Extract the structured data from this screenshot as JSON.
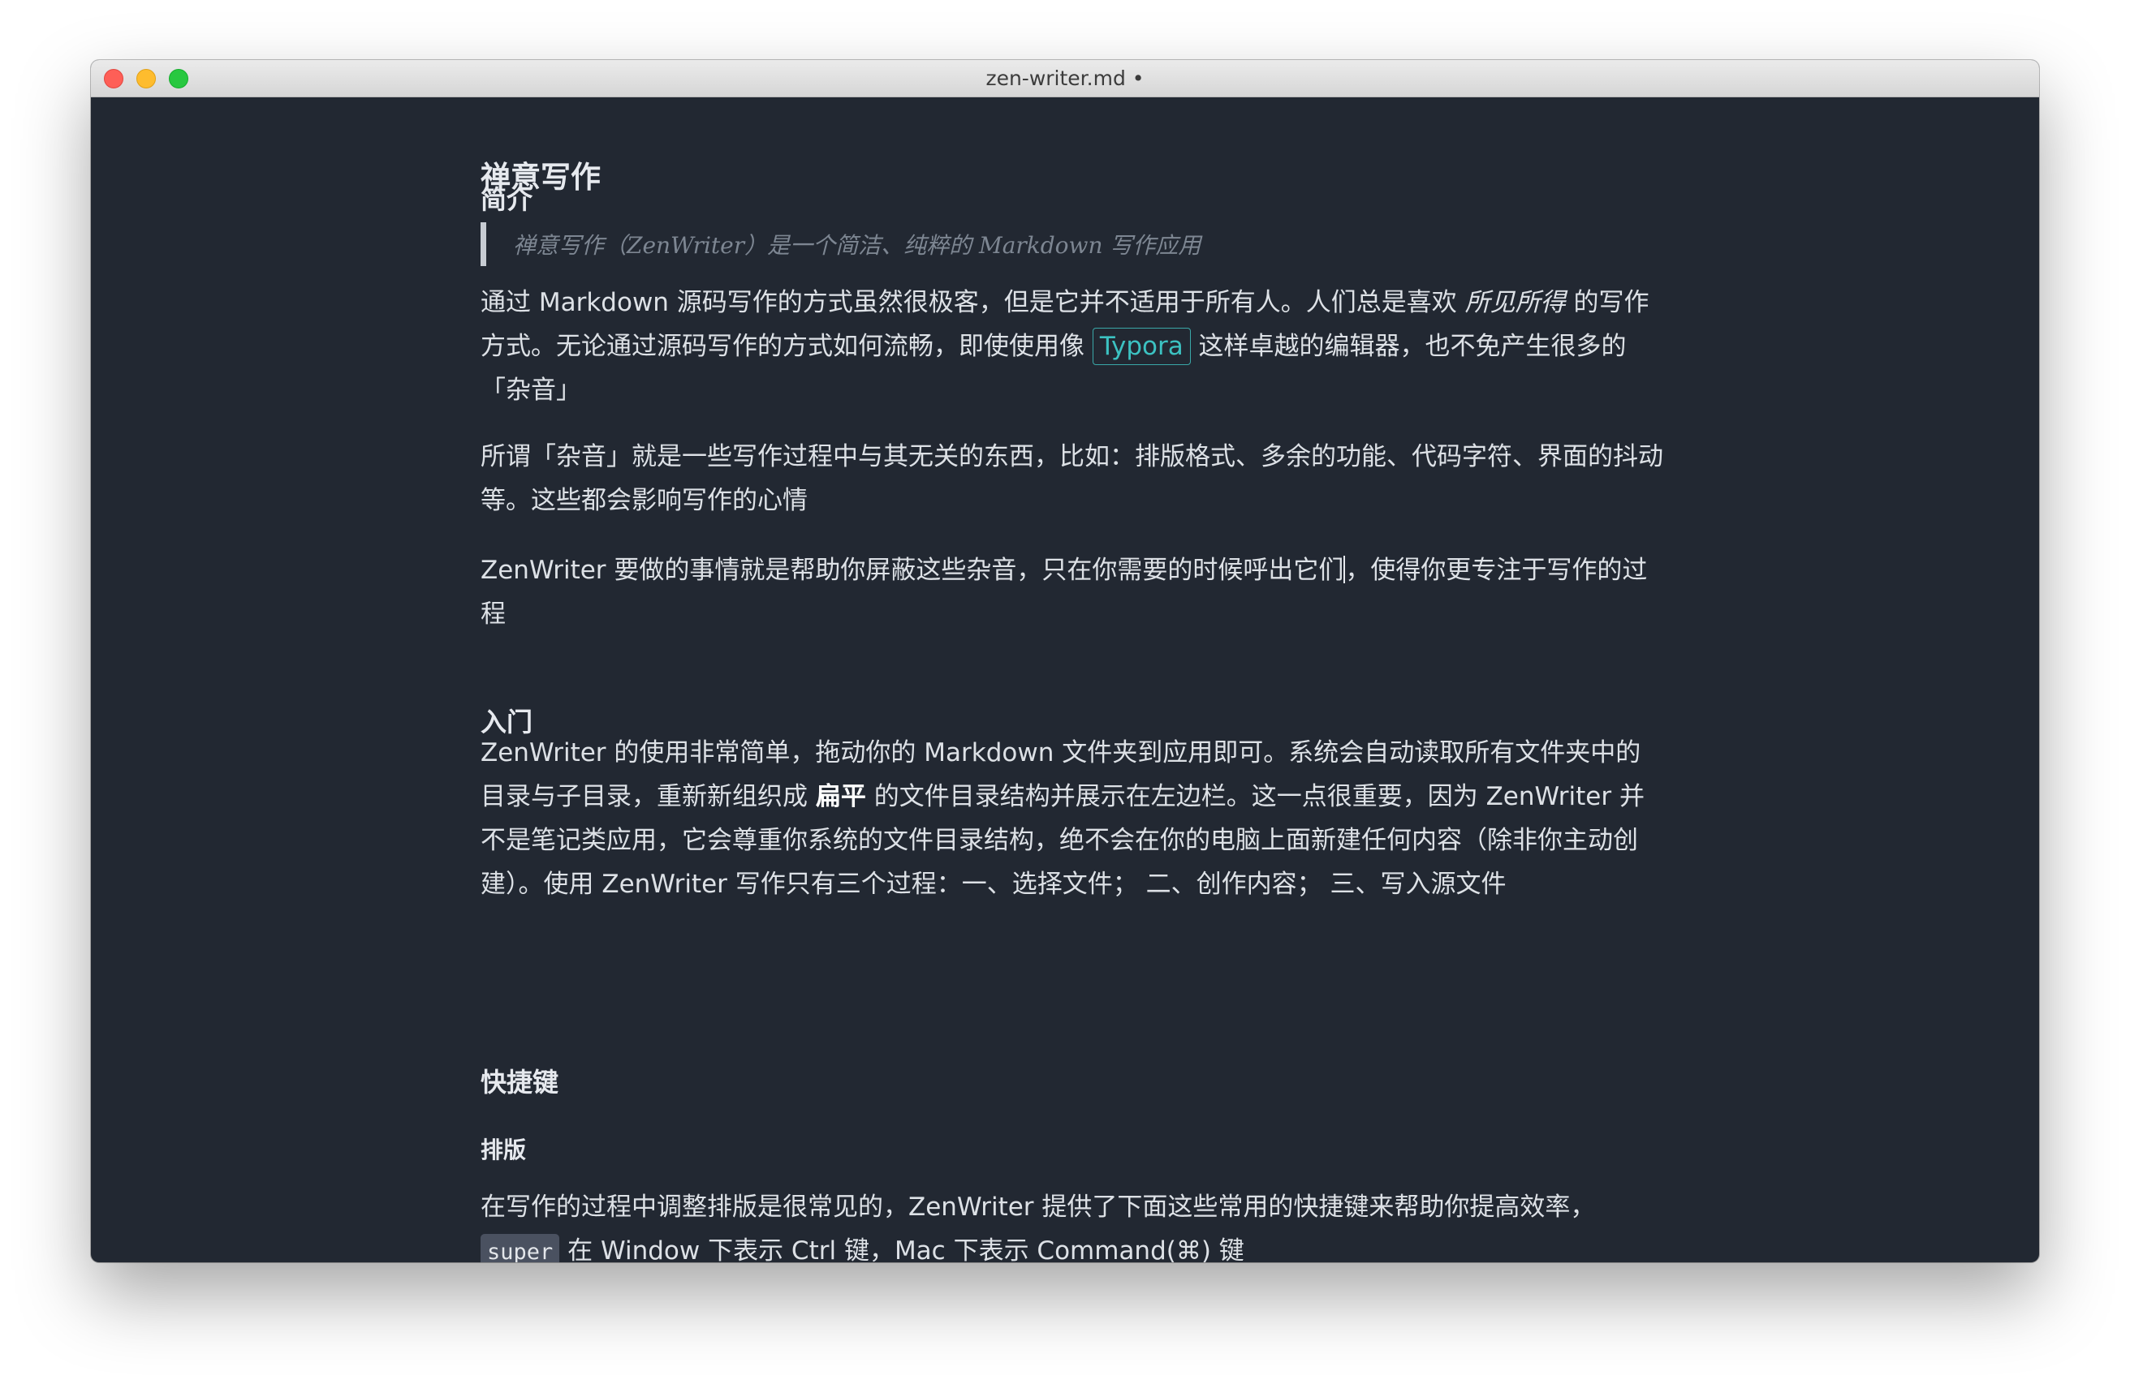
{
  "window": {
    "title": "zen-writer.md •"
  },
  "doc": {
    "title": "禅意写作",
    "intro_heading": "简介",
    "blockquote": "禅意写作（ZenWriter）是一个简洁、纯粹的 Markdown 写作应用",
    "p1_a": "通过 Markdown 源码写作的方式虽然很极客，但是它并不适用于所有人。人们总是喜欢 ",
    "p1_em": "所见所得",
    "p1_b": " 的写作方式。无论通过源码写作的方式如何流畅，即使使用像 ",
    "p1_link": "Typora",
    "p1_c": " 这样卓越的编辑器，也不免产生很多的「杂音」",
    "p2": "所谓「杂音」就是一些写作过程中与其无关的东西，比如：排版格式、多余的功能、代码字符、界面的抖动等。这些都会影响写作的心情",
    "p3_a": "ZenWriter 要做的事情就是帮助你屏蔽这些杂音，只在你需要的时候呼出它们",
    "p3_b": "，使得你更专注于写作的过程",
    "start_heading": "入门",
    "p4_a": "ZenWriter 的使用非常简单，拖动你的 Markdown 文件夹到应用即可。系统会自动读取所有文件夹中的目录与子目录，重新新组织成 ",
    "p4_strong": "扁平",
    "p4_b": " 的文件目录结构并展示在左边栏。这一点很重要，因为 ZenWriter 并不是笔记类应用，它会尊重你系统的文件目录结构，绝不会在你的电脑上面新建任何内容（除非你主动创建）。使用 ZenWriter 写作只有三个过程：一、选择文件； 二、创作内容； 三、写入源文件",
    "shortcuts_heading": "快捷键",
    "layout_heading": "排版",
    "p5_a": "在写作的过程中调整排版是很常见的，ZenWriter 提供了下面这些常用的快捷键来帮助你提高效率，",
    "p5_code": "super",
    "p5_b": " 在 Window 下表示 Ctrl 键，Mac 下表示 Command(⌘) 键"
  }
}
